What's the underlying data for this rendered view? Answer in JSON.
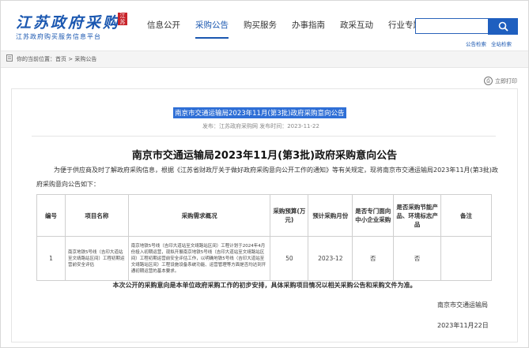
{
  "header": {
    "logo_cn": "江苏政府采购",
    "logo_seal": "江苏",
    "logo_sub": "江苏政府购买服务信息平台",
    "nav": [
      "信息公开",
      "采购公告",
      "购买服务",
      "办事指南",
      "政采互动",
      "行业专题"
    ],
    "search_value": "",
    "search_links": [
      "公告检索",
      "全站检索"
    ]
  },
  "breadcrumb": "你的当前位置：首页 > 采购公告",
  "print_label": "立即打印",
  "article": {
    "highlight_title": "南京市交通运输局2023年11月(第3批)政府采购意向公告",
    "meta": "发布：江苏政府采购网    发布时间：2023-11-22",
    "title": "南京市交通运输局2023年11月(第3批)政府采购意向公告",
    "intro": "为便于供应商及时了解政府采购信息，根据《江苏省财政厅关于做好政府采购意向公开工作的通知》等有关规定，现将南京市交通运输局2023年11月(第3批)政府采购意向公告如下：",
    "table": {
      "headers": [
        "编号",
        "项目名称",
        "采购需求概况",
        "采购预算(万元)",
        "预计采购月份",
        "是否专门面向中小企业采购",
        "是否采购节能产品、环境标志产品",
        "备注"
      ],
      "rows": [
        [
          "1",
          "南京地铁5号线（吉印大道站至文靖路站区间）工程初期运营前安全评估",
          "南京地铁5号线（吉印大道站至文靖路站区间）工程计划于2024年4月份投入初期运营，现拟开展南京地铁5号线（吉印大道站至文靖路站区间）工程初期运营前安全评估工作，以明确地铁5号线（吉印大道站至文靖路站区间）工程设施设备系统功能、运营管理等方面是否均达到开通初期运营的基本要求。",
          "50",
          "2023-12",
          "否",
          "否",
          ""
        ]
      ]
    },
    "note": "本次公开的采购意向是本单位政府采购工作的初步安排，具体采购项目情况以相关采购公告和采购文件为准。",
    "signature": "南京市交通运输局",
    "date": "2023年11月22日"
  },
  "colors": {
    "brand": "#1a57b0",
    "search_button": "#1f5fbf",
    "highlight": "#2f6fd6"
  }
}
